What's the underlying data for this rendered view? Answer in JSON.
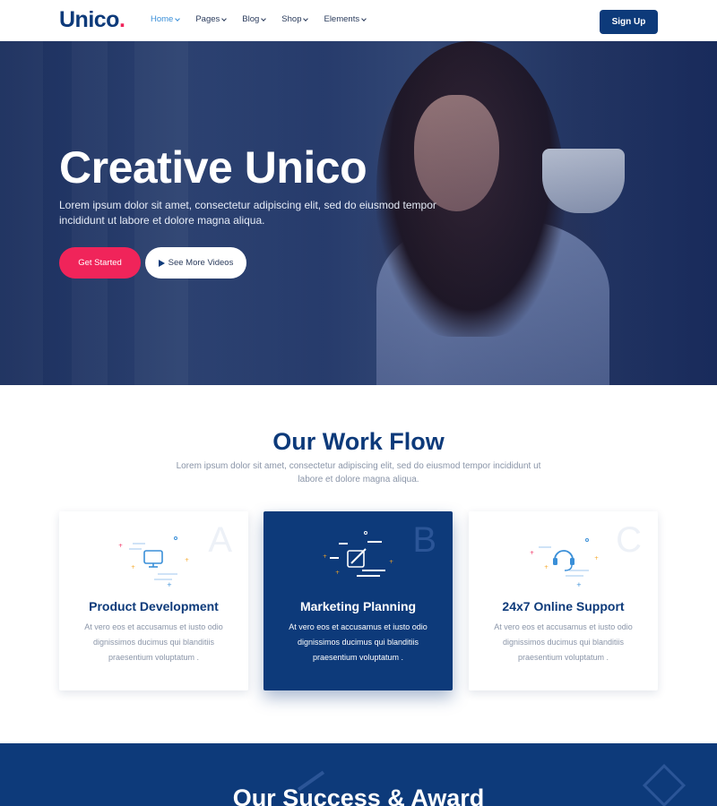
{
  "brand": {
    "name": "Unico",
    "dot": ".",
    "accent": "#f0245a",
    "primary": "#0d3a7a"
  },
  "nav": {
    "items": [
      {
        "label": "Home",
        "active": true
      },
      {
        "label": "Pages",
        "active": false
      },
      {
        "label": "Blog",
        "active": false
      },
      {
        "label": "Shop",
        "active": false
      },
      {
        "label": "Elements",
        "active": false
      }
    ],
    "signup_label": "Sign Up"
  },
  "hero": {
    "title": "Creative Unico",
    "subtitle": "Lorem ipsum dolor sit amet, consectetur adipiscing elit, sed do eiusmod tempor incididunt ut labore et dolore magna aliqua.",
    "primary_button": "Get Started",
    "secondary_button": "See More Videos"
  },
  "workflow": {
    "title": "Our Work Flow",
    "subtitle": "Lorem ipsum dolor sit amet, consectetur adipiscing elit, sed do eiusmod tempor incididunt ut labore et dolore magna aliqua.",
    "cards": [
      {
        "letter": "A",
        "title": "Product Development",
        "text": "At vero eos et accusamus et iusto odio dignissimos ducimus qui blanditiis praesentium voluptatum .",
        "icon": "monitor-icon"
      },
      {
        "letter": "B",
        "title": "Marketing Planning",
        "text": "At vero eos et accusamus et iusto odio dignissimos ducimus qui blanditiis praesentium voluptatum .",
        "icon": "pencil-paper-icon"
      },
      {
        "letter": "C",
        "title": "24x7 Online Support",
        "text": "At vero eos et accusamus et iusto odio dignissimos ducimus qui blanditiis praesentium voluptatum .",
        "icon": "headset-icon"
      }
    ]
  },
  "success": {
    "title": "Our Success & Award"
  }
}
